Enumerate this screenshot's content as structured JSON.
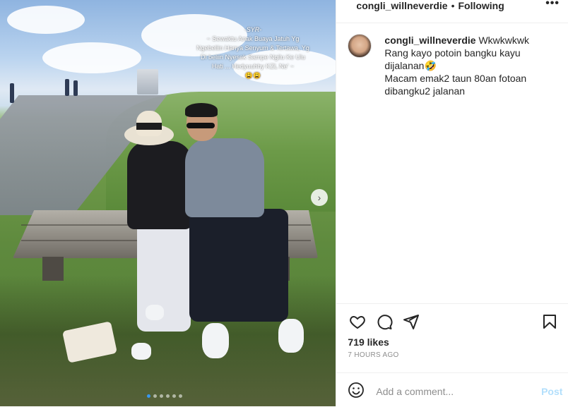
{
  "post": {
    "username": "congli_willneverdie",
    "separator": "•",
    "follow_state": "Following",
    "more_label": "•••"
  },
  "photo_overlay": {
    "title": "-SYR-",
    "text": "~ Sewaktu Anak Buaya Jatuh Yg Ngebeliin Hanya Senyum & Tertawa, Yg Di beliin Nyesek Sampe Ngilu Ke Ulu Hati ... Hedyuuhhy KZL Ne' ~",
    "emoji": "😩😩"
  },
  "caption": {
    "username": "congli_willneverdie",
    "line1": "Wkwkwkwk",
    "line2": "Rang kayo potoin bangku kayu dijalanan🤣",
    "line3": "Macam emak2 taun 80an fotoan dibangku2 jalanan"
  },
  "engagement": {
    "likes": "719 likes",
    "timestamp": "7 HOURS AGO"
  },
  "comment_box": {
    "placeholder": "Add a comment...",
    "post_label": "Post"
  },
  "icons": {
    "like": "heart-icon",
    "comment": "comment-icon",
    "share": "share-icon",
    "save": "bookmark-icon",
    "emoji": "emoji-icon",
    "next": "chevron-right-icon"
  },
  "carousel": {
    "slide_count": 6,
    "active_index": 0
  },
  "colors": {
    "link": "#3897f0",
    "post_disabled": "#b2dffc",
    "muted": "#8e8e8e"
  }
}
